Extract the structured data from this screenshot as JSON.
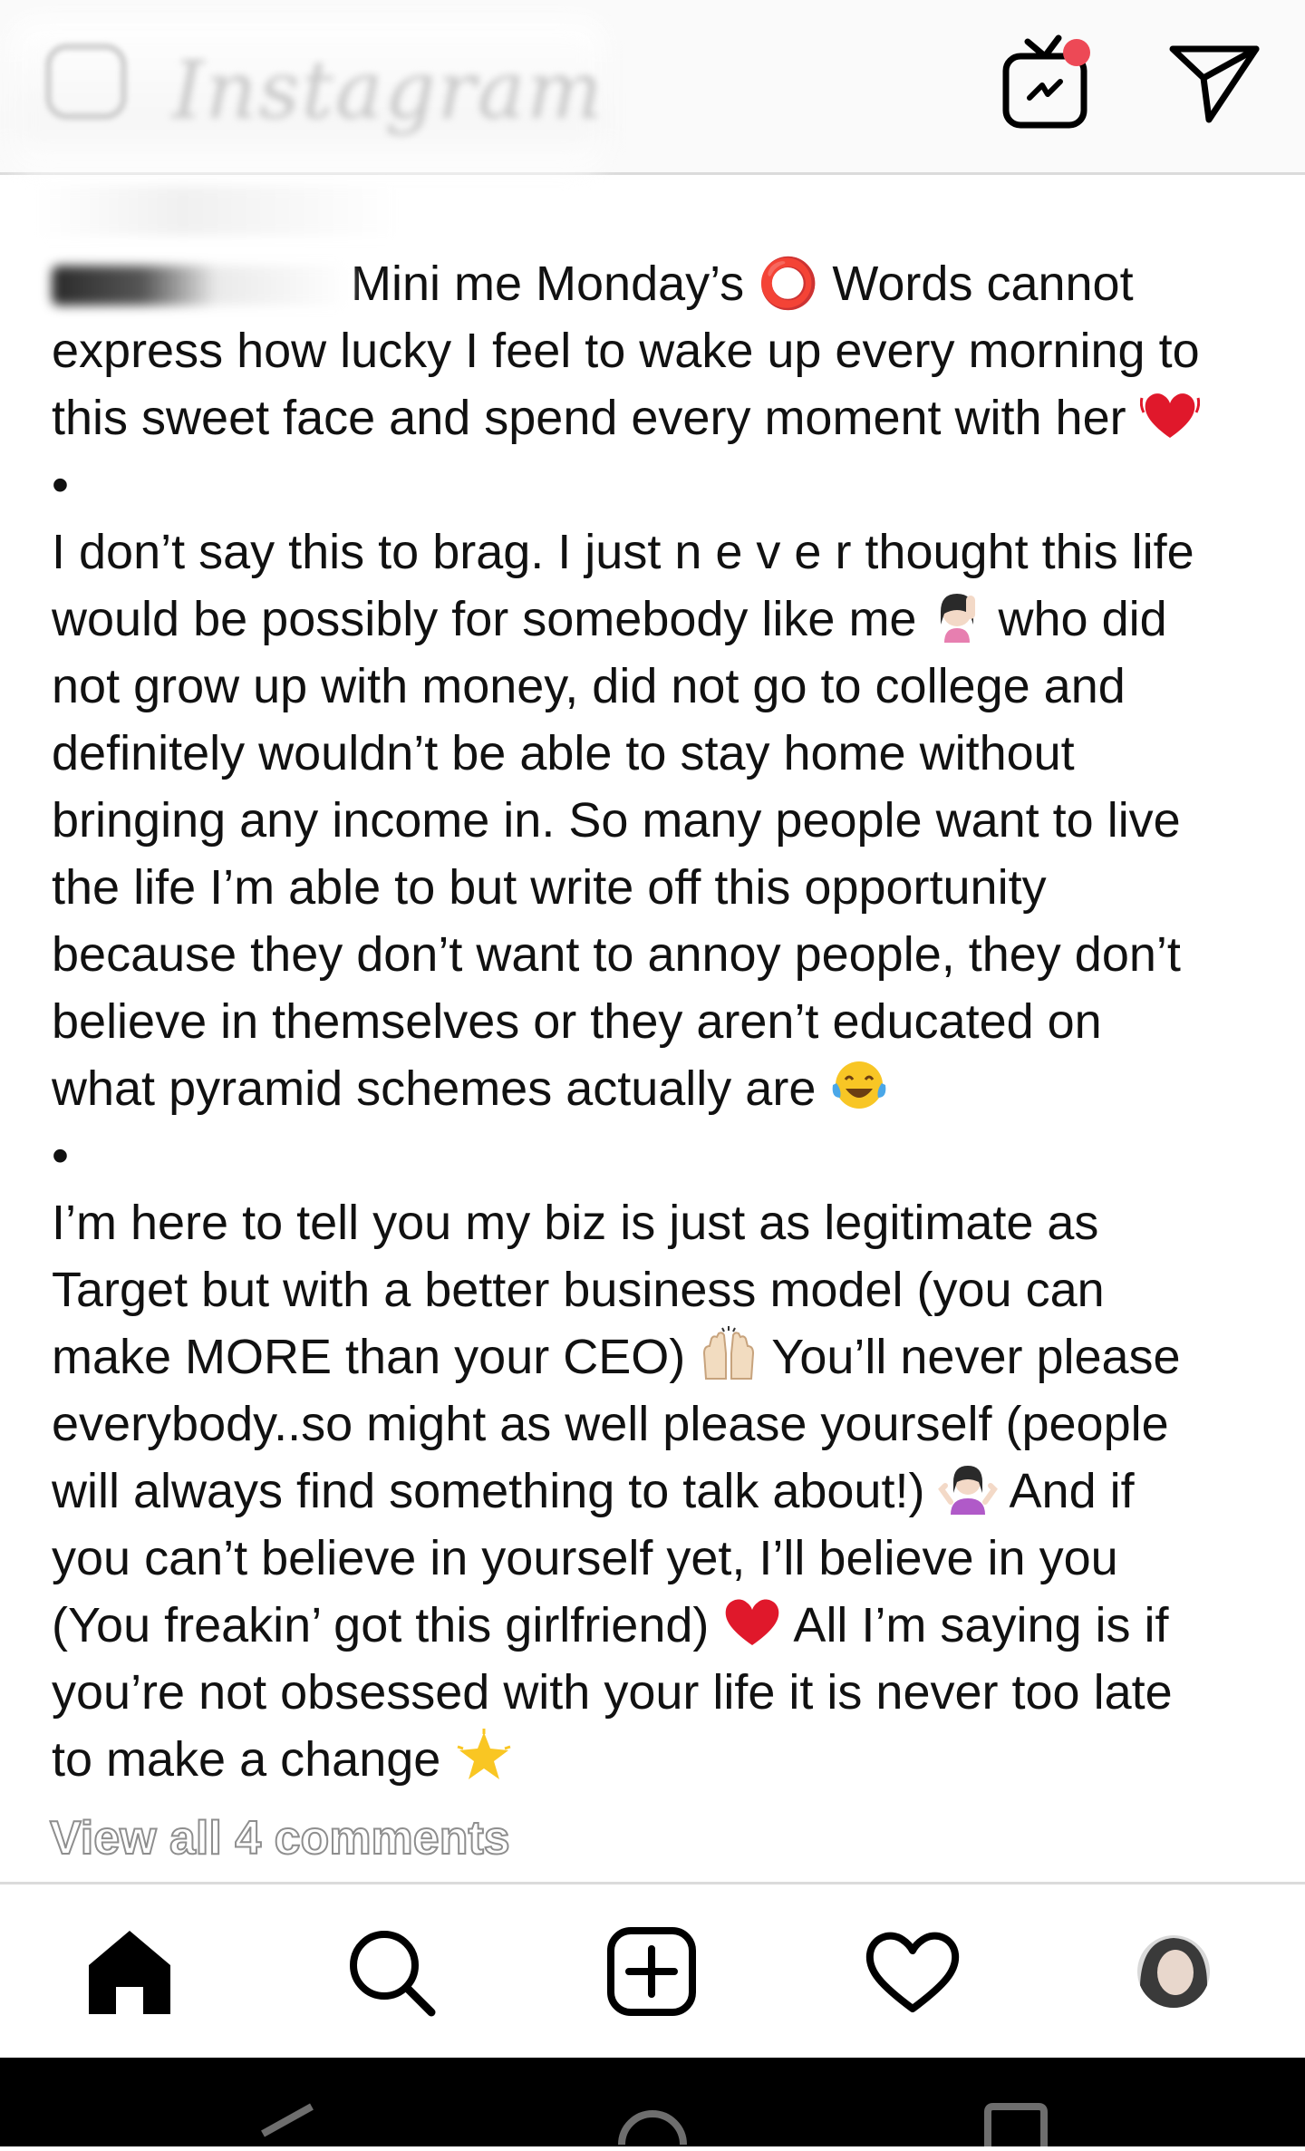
{
  "caption": {
    "line1_rest": "Mini me Monday’s ⭕ Words cannot",
    "line2": "express how lucky I feel to wake up every morning to",
    "line3": "this sweet face and spend every moment with her",
    "bullet1": "•",
    "line5": "I don’t say this to brag. I just n e v e r thought this life",
    "line6_a": "would be possibly for somebody like me",
    "line6_b": "who did",
    "line7": "not grow up with money, did not go to college and",
    "line8": "definitely wouldn’t be able to stay home without",
    "line9": "bringing any income in. So many people want to live",
    "line10": "the life I’m able to but write off this opportunity",
    "line11": "because they don’t want to annoy people, they don’t",
    "line12": "believe in themselves or they aren’t educated on",
    "line13": "what pyramid schemes actually are",
    "bullet2": "•",
    "line15": "I’m here to tell you my biz is just as legitimate as",
    "line16": "Target but with a better business model (you can",
    "line17_a": "make MORE than your CEO)",
    "line17_b": "You’ll never please",
    "line18": "everybody..so might as well please yourself (people",
    "line19_a": "will always find something to talk about!)",
    "line19_b": "And if",
    "line20": "you can’t believe in yourself yet, I’ll believe in you",
    "line21_a": "(You freakin’ got this girlfriend)",
    "line21_b": "All I’m saying is if",
    "line22": "you’re not obsessed with your life it is never too late",
    "line23": "to make a change"
  },
  "comments_link": "View all 4 comments",
  "icons": {
    "igtv": "igtv-icon",
    "direct": "direct-message-icon",
    "home": "home-icon",
    "search": "search-icon",
    "new_post": "new-post-icon",
    "activity": "heart-icon",
    "profile": "profile-avatar"
  },
  "colors": {
    "notification_dot": "#ed4956",
    "text": "#111111",
    "divider": "#dbdbdb"
  }
}
